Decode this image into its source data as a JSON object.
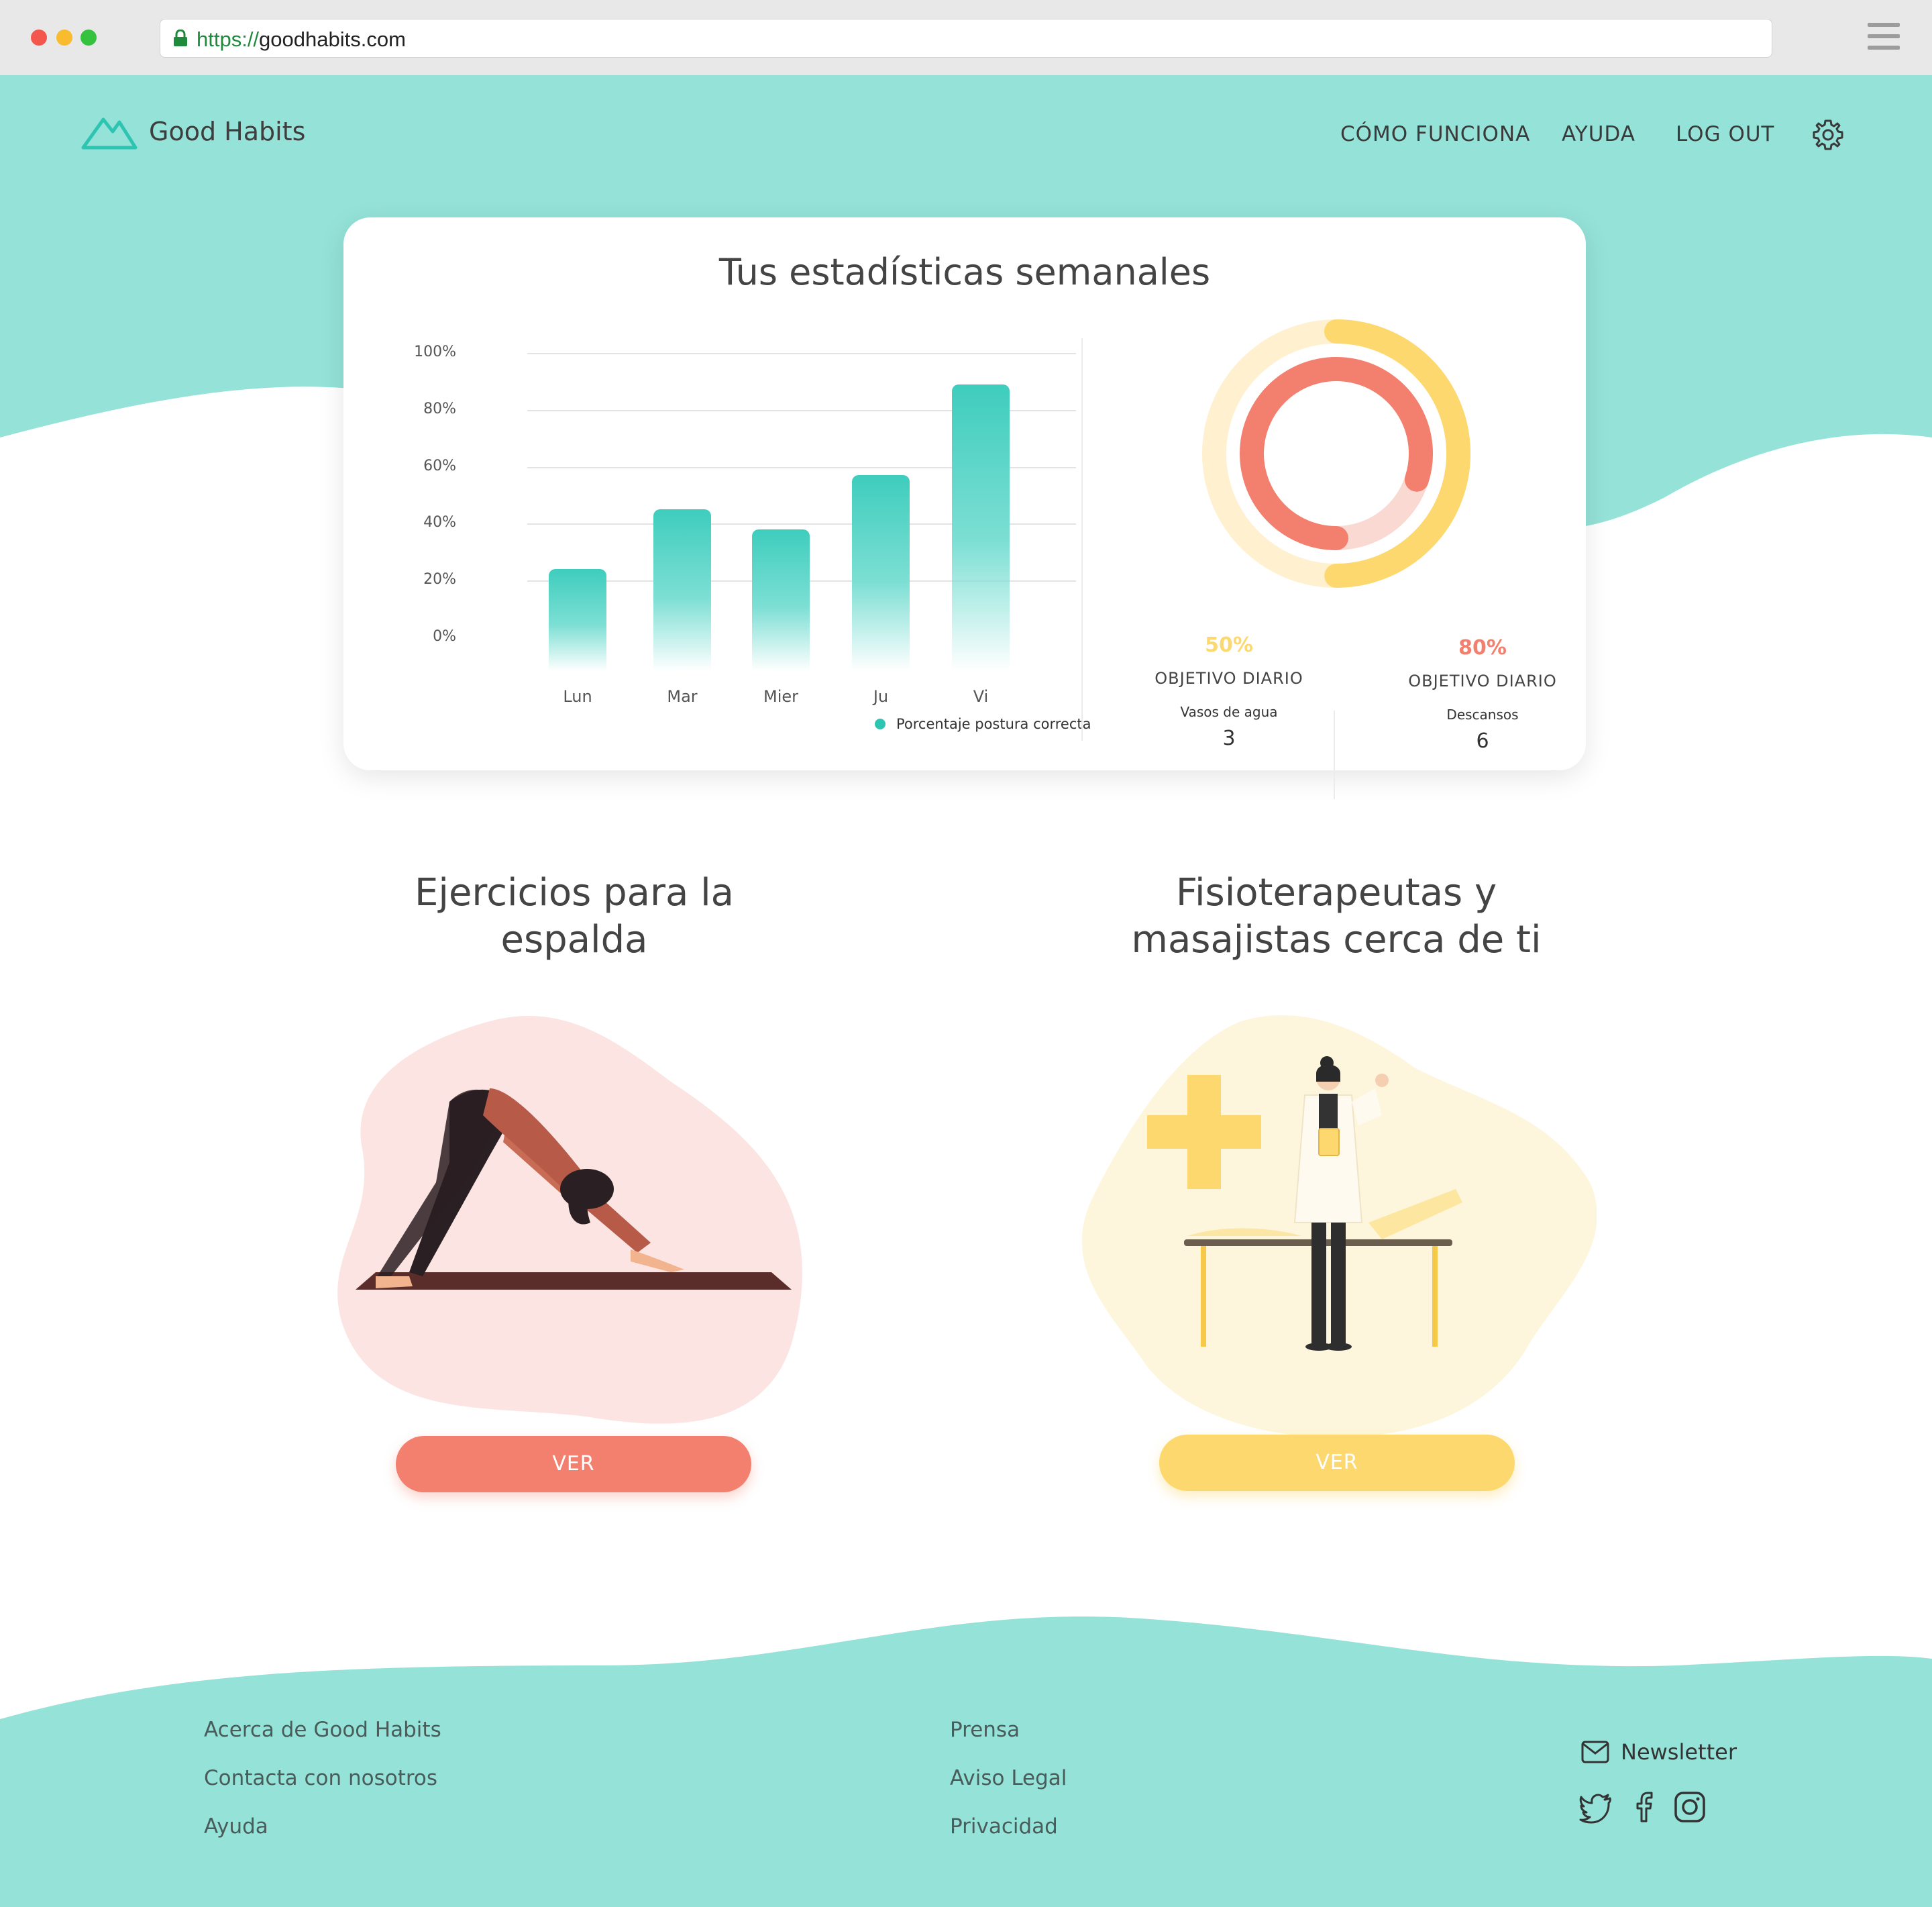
{
  "browser": {
    "url_scheme": "https://",
    "url_host": "goodhabits.com"
  },
  "header": {
    "brand": "Good Habits",
    "nav": [
      "CÓMO FUNCIONA",
      "AYUDA",
      "LOG OUT"
    ]
  },
  "stats": {
    "title": "Tus estadísticas semanales",
    "metrics": [
      {
        "percent": "50%",
        "label": "OBJETIVO DIARIO",
        "sublabel": "Vasos de agua",
        "value": "3",
        "color": "#fdd86f"
      },
      {
        "percent": "80%",
        "label": "OBJETIVO DIARIO",
        "sublabel": "Descansos",
        "value": "6",
        "color": "#f3806f"
      }
    ]
  },
  "chart_data": {
    "type": "bar",
    "categories": [
      "Lun",
      "Mar",
      "Mier",
      "Ju",
      "Vi"
    ],
    "series": [
      {
        "name": "Porcentaje postura correcta",
        "values": [
          24,
          45,
          38,
          57,
          89
        ]
      }
    ],
    "y_ticks": [
      "100%",
      "80%",
      "60%",
      "40%",
      "20%",
      "0%"
    ],
    "ylim": [
      0,
      100
    ],
    "grid": true,
    "legend": "bottom-right",
    "bar_color": "#3ecdbd"
  },
  "sections": [
    {
      "title_line1": "Ejercicios para la",
      "title_line2": "espalda",
      "button": "VER",
      "accent": "#f3806f"
    },
    {
      "title_line1": "Fisioterapeutas y",
      "title_line2": "masajistas cerca de ti",
      "button": "VER",
      "accent": "#fdd86f"
    }
  ],
  "footer": {
    "col1": [
      "Acerca de Good Habits",
      "Contacta con nosotros",
      "Ayuda"
    ],
    "col2": [
      "Prensa",
      "Aviso Legal",
      "Privacidad"
    ],
    "newsletter": "Newsletter",
    "social_icons": [
      "twitter-icon",
      "facebook-icon",
      "instagram-icon"
    ]
  },
  "colors": {
    "mint": "#94e2d8",
    "teal": "#2ec4b2",
    "coral": "#f3806f",
    "yellow": "#fdd86f"
  }
}
